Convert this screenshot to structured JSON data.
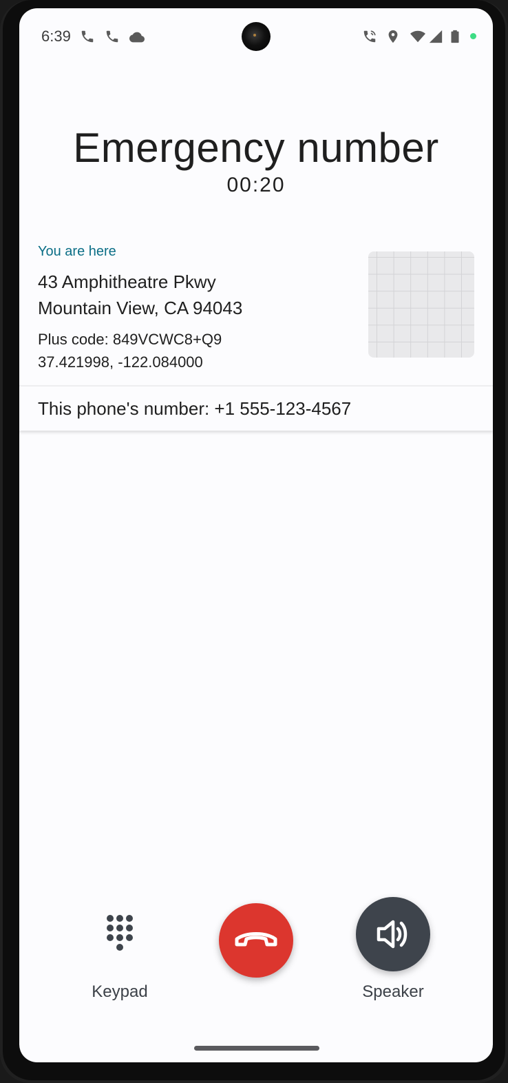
{
  "status_bar": {
    "time": "6:39",
    "left_icons": [
      "phone-icon",
      "phone-icon",
      "cloud-icon"
    ],
    "right_icons": [
      "wifi-calling-icon",
      "location-icon",
      "wifi-icon",
      "signal-icon",
      "battery-icon"
    ],
    "indicator_color": "#3ddc84"
  },
  "call": {
    "title": "Emergency number",
    "timer": "00:20"
  },
  "location": {
    "heading": "You are here",
    "address_line1": "43 Amphitheatre Pkwy",
    "address_line2": "Mountain View, CA 94043",
    "plus_code": "Plus code: 849VCWC8+Q9",
    "coordinates": "37.421998, -122.084000"
  },
  "phone_number": {
    "text": "This phone's number: +1 555-123-4567"
  },
  "controls": {
    "keypad_label": "Keypad",
    "speaker_label": "Speaker",
    "end_call_color": "#dc362e",
    "speaker_bg_color": "#3e444c"
  }
}
